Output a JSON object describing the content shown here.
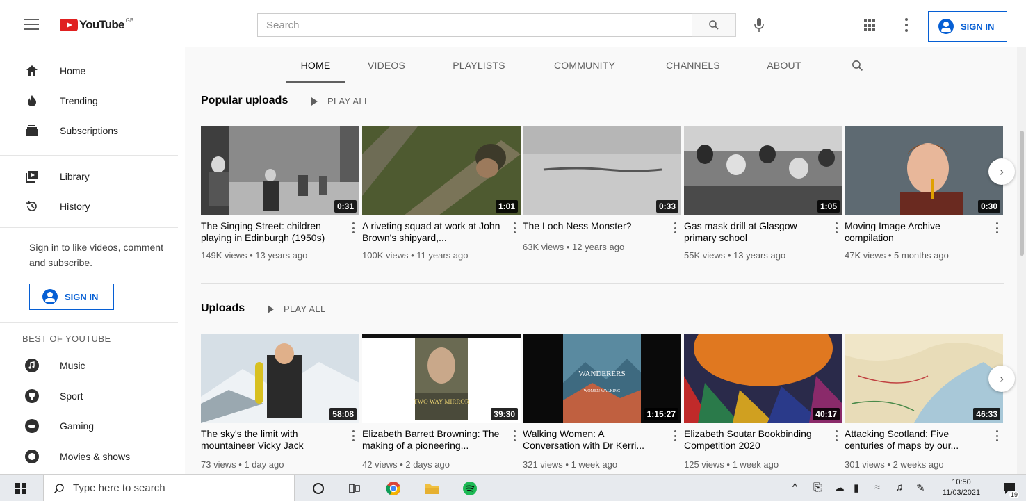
{
  "header": {
    "logo_text": "YouTube",
    "logo_sup": "GB",
    "search_placeholder": "Search",
    "signin_label": "SIGN IN"
  },
  "sidebar": {
    "items_top": [
      {
        "label": "Home",
        "icon": "home-icon"
      },
      {
        "label": "Trending",
        "icon": "flame-icon"
      },
      {
        "label": "Subscriptions",
        "icon": "subscriptions-icon"
      }
    ],
    "items_mid": [
      {
        "label": "Library",
        "icon": "library-icon"
      },
      {
        "label": "History",
        "icon": "history-icon"
      }
    ],
    "signin_prompt": "Sign in to like videos, comment and subscribe.",
    "signin_label": "SIGN IN",
    "best_heading": "BEST OF YOUTUBE",
    "best_items": [
      {
        "label": "Music",
        "icon": "music-icon"
      },
      {
        "label": "Sport",
        "icon": "sport-icon"
      },
      {
        "label": "Gaming",
        "icon": "gaming-icon"
      },
      {
        "label": "Movies & shows",
        "icon": "movies-icon"
      }
    ]
  },
  "tabs": [
    "HOME",
    "VIDEOS",
    "PLAYLISTS",
    "COMMUNITY",
    "CHANNELS",
    "ABOUT"
  ],
  "active_tab": "HOME",
  "popular": {
    "title": "Popular uploads",
    "play_all": "PLAY ALL",
    "videos": [
      {
        "title": "The Singing Street: children playing in Edinburgh (1950s)",
        "meta": "149K views • 13 years ago",
        "duration": "0:31"
      },
      {
        "title": "A riveting squad at work at John Brown's shipyard,...",
        "meta": "100K views • 11 years ago",
        "duration": "1:01"
      },
      {
        "title": "The Loch Ness Monster?",
        "meta": "63K views • 12 years ago",
        "duration": "0:33"
      },
      {
        "title": "Gas mask drill at Glasgow primary school",
        "meta": "55K views • 13 years ago",
        "duration": "1:05"
      },
      {
        "title": "Moving Image Archive compilation",
        "meta": "47K views • 5 months ago",
        "duration": "0:30"
      }
    ]
  },
  "uploads": {
    "title": "Uploads",
    "play_all": "PLAY ALL",
    "videos": [
      {
        "title": "The sky's the limit with mountaineer Vicky Jack",
        "meta": "73 views • 1 day ago",
        "duration": "58:08"
      },
      {
        "title": "Elizabeth Barrett Browning: The making of a pioneering...",
        "meta": "42 views • 2 days ago",
        "duration": "39:30"
      },
      {
        "title": "Walking Women: A Conversation with Dr Kerri...",
        "meta": "321 views • 1 week ago",
        "duration": "1:15:27"
      },
      {
        "title": "Elizabeth Soutar Bookbinding Competition 2020",
        "meta": "125 views • 1 week ago",
        "duration": "40:17"
      },
      {
        "title": "Attacking Scotland: Five centuries of maps by our...",
        "meta": "301 views • 2 weeks ago",
        "duration": "46:33"
      }
    ]
  },
  "thumb_text": {
    "mirror": "TWO WAY MIRROR",
    "wanderers": "WANDERERS",
    "wanderers_sub": "WOMEN WALKING"
  },
  "taskbar": {
    "search_placeholder": "Type here to search",
    "time": "10:50",
    "date": "11/03/2021",
    "notifications": "19"
  },
  "colors": {
    "brand_red": "#e02020",
    "link_blue": "#065fd4"
  }
}
